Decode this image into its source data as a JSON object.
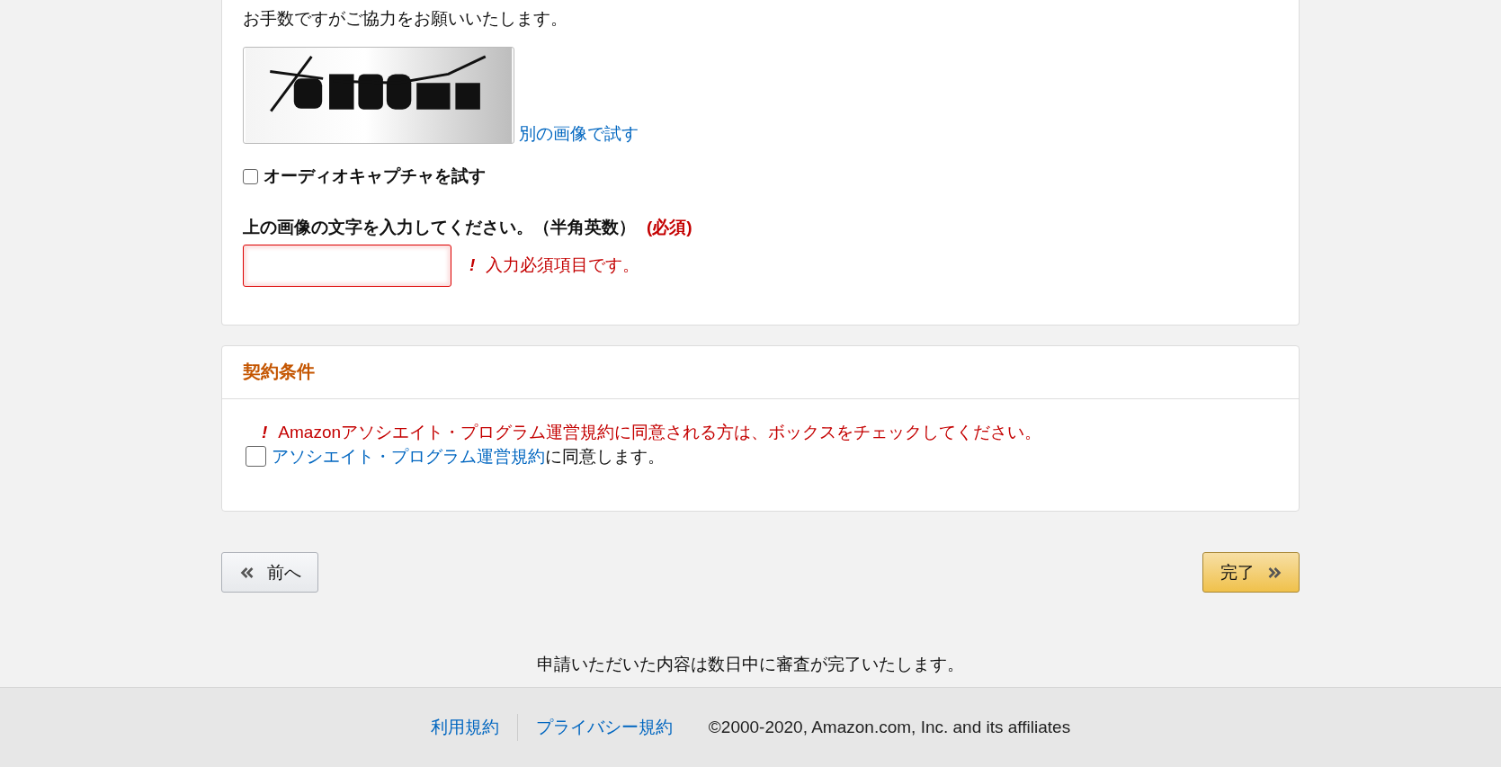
{
  "intro": {
    "text": "お手数ですがご協力をお願いいたします。"
  },
  "captcha": {
    "refresh_link": "別の画像で試す",
    "audio_option": {
      "label": "オーディオキャプチャを試す",
      "checked": false
    },
    "field_label": "上の画像の文字を入力してください。（半角英数）",
    "required_mark": "(必須)",
    "input": {
      "invalid": true
    },
    "error_mark": "!",
    "error": "入力必須項目です。"
  },
  "terms": {
    "title": "契約条件",
    "error_mark": "!",
    "error": "Amazonアソシエイト・プログラム運営規約に同意される方は、ボックスをチェックしてください。",
    "agree": {
      "link": "アソシエイト・プログラム運営規約",
      "text": "に同意します。",
      "checked": false
    }
  },
  "nav": {
    "back": "前へ",
    "finish": "完了"
  },
  "notice": "申請いただいた内容は数日中に審査が完了いたします。",
  "footer": {
    "links": [
      "利用規約",
      "プライバシー規約"
    ],
    "copyright": "©2000-2020, Amazon.com, Inc. and its affiliates"
  }
}
